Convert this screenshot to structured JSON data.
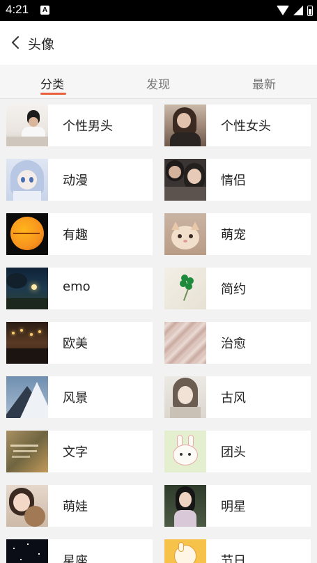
{
  "status_bar": {
    "time": "4:21",
    "notification_glyph": "A"
  },
  "header": {
    "back_icon": "chevron-left-icon",
    "title": "头像"
  },
  "tabs": [
    {
      "label": "分类",
      "active": true
    },
    {
      "label": "发现",
      "active": false
    },
    {
      "label": "最新",
      "active": false
    }
  ],
  "accent_color": "#e8603c",
  "categories": [
    {
      "label": "个性男头",
      "thumb": "boy-portrait"
    },
    {
      "label": "个性女头",
      "thumb": "girl-portrait"
    },
    {
      "label": "动漫",
      "thumb": "anime-girl"
    },
    {
      "label": "情侣",
      "thumb": "couple"
    },
    {
      "label": "有趣",
      "thumb": "orange-sun"
    },
    {
      "label": "萌宠",
      "thumb": "cat"
    },
    {
      "label": "emo",
      "thumb": "night-tree"
    },
    {
      "label": "简约",
      "thumb": "clover"
    },
    {
      "label": "欧美",
      "thumb": "city-lights"
    },
    {
      "label": "治愈",
      "thumb": "pink-texture"
    },
    {
      "label": "风景",
      "thumb": "snow-mountain"
    },
    {
      "label": "古风",
      "thumb": "ancient-style"
    },
    {
      "label": "文字",
      "thumb": "text-blur"
    },
    {
      "label": "团头",
      "thumb": "bunny-cartoon"
    },
    {
      "label": "萌娃",
      "thumb": "baby-girl"
    },
    {
      "label": "明星",
      "thumb": "celebrity"
    },
    {
      "label": "星座",
      "thumb": "starry-night"
    },
    {
      "label": "节日",
      "thumb": "festival-cartoon"
    }
  ]
}
